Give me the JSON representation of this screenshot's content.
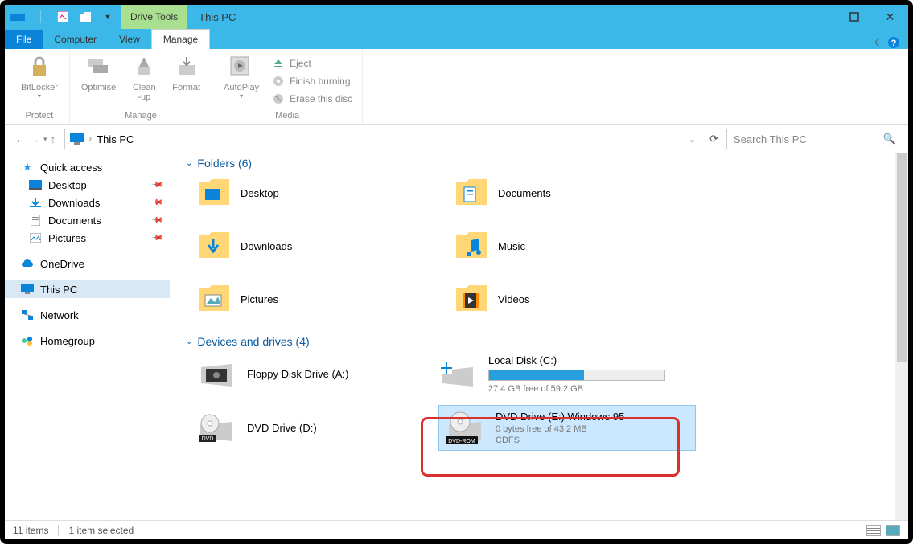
{
  "window": {
    "tools_tab": "Drive Tools",
    "title": "This PC"
  },
  "tabs": {
    "file": "File",
    "computer": "Computer",
    "view": "View",
    "manage": "Manage"
  },
  "ribbon": {
    "bitlocker": "BitLocker",
    "optimise": "Optimise",
    "cleanup_l1": "Clean",
    "cleanup_l2": "-up",
    "format": "Format",
    "autoplay": "AutoPlay",
    "eject": "Eject",
    "finish": "Finish burning",
    "erase": "Erase this disc",
    "group_protect": "Protect",
    "group_manage": "Manage",
    "group_media": "Media"
  },
  "nav": {
    "location": "This PC",
    "search_placeholder": "Search This PC"
  },
  "sidebar": {
    "quick_access": "Quick access",
    "desktop": "Desktop",
    "downloads": "Downloads",
    "documents": "Documents",
    "pictures": "Pictures",
    "onedrive": "OneDrive",
    "this_pc": "This PC",
    "network": "Network",
    "homegroup": "Homegroup"
  },
  "sections": {
    "folders": "Folders (6)",
    "drives": "Devices and drives (4)"
  },
  "folders": {
    "desktop": "Desktop",
    "documents": "Documents",
    "downloads": "Downloads",
    "music": "Music",
    "pictures": "Pictures",
    "videos": "Videos"
  },
  "drives": {
    "floppy": {
      "name": "Floppy Disk Drive (A:)"
    },
    "local": {
      "name": "Local Disk (C:)",
      "free": "27.4 GB free of 59.2 GB",
      "fill_pct": 54
    },
    "dvd_d": {
      "name": "DVD Drive (D:)"
    },
    "dvd_e": {
      "name": "DVD Drive (E:) Windows 95",
      "free": "0 bytes free of 43.2 MB",
      "fs": "CDFS",
      "badge": "DVD-ROM"
    }
  },
  "status": {
    "count": "11 items",
    "selected": "1 item selected"
  }
}
